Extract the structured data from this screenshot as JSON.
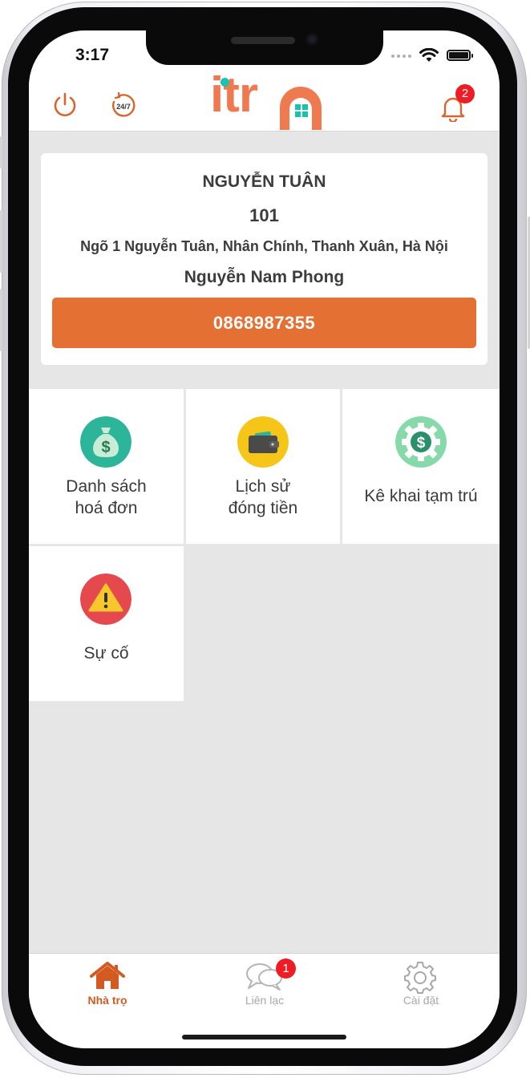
{
  "status_bar": {
    "time": "3:17"
  },
  "header": {
    "logo_text": "itr",
    "support_label": "24/7",
    "notification_count": "2"
  },
  "info_card": {
    "name": "NGUYỄN TUÂN",
    "room": "101",
    "address": "Ngõ 1 Nguyễn Tuân, Nhân Chính, Thanh Xuân, Hà Nội",
    "owner": "Nguyễn Nam Phong",
    "phone": "0868987355"
  },
  "menu": {
    "items": [
      {
        "line1": "Danh sách",
        "line2": "hoá đơn",
        "icon": "money-bag-icon"
      },
      {
        "line1": "Lịch sử",
        "line2": "đóng tiền",
        "icon": "wallet-icon"
      },
      {
        "line1": "Kê khai tạm trú",
        "icon": "dollar-gear-icon"
      },
      {
        "line1": "Sự cố",
        "icon": "warning-icon"
      }
    ]
  },
  "tabbar": {
    "tabs": [
      {
        "label": "Nhà trọ",
        "icon": "home-icon",
        "active": true
      },
      {
        "label": "Liên lạc",
        "icon": "chat-icon",
        "badge": "1"
      },
      {
        "label": "Cài đặt",
        "icon": "gear-icon"
      }
    ]
  },
  "colors": {
    "accent": "#e57034",
    "logo": "#f07a50",
    "badge": "#ee1c24",
    "background": "#e6e6e6"
  }
}
